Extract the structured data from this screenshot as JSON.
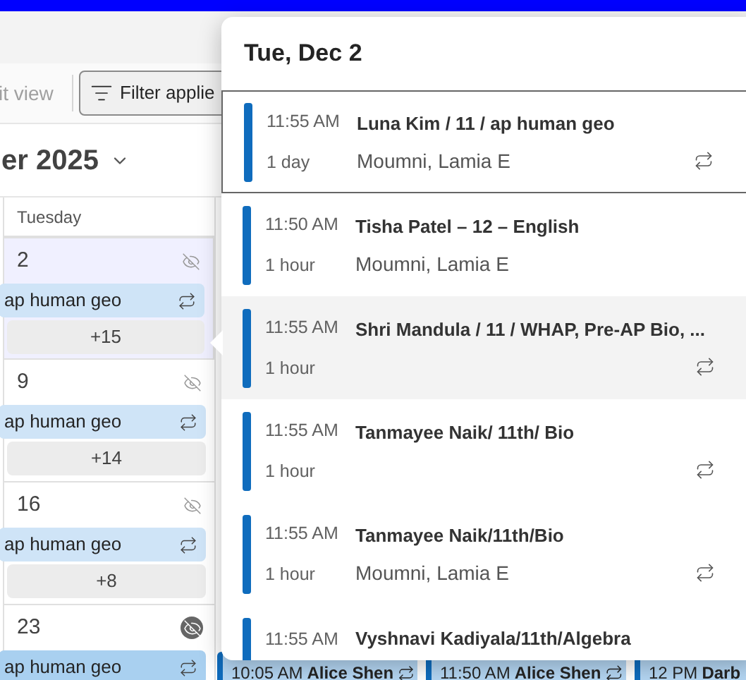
{
  "toolbar": {
    "view_button": "it view",
    "filter_button": "Filter applie"
  },
  "month_title": "er 2025",
  "day_header": "Tuesday",
  "weeks": [
    {
      "date": "2",
      "selected": true,
      "emphasized": false,
      "event": "ap human geo",
      "more": "+15"
    },
    {
      "date": "9",
      "selected": false,
      "emphasized": false,
      "event": "ap human geo",
      "more": "+14"
    },
    {
      "date": "16",
      "selected": false,
      "emphasized": false,
      "event": "ap human geo",
      "more": "+8"
    },
    {
      "date": "23",
      "selected": false,
      "emphasized": true,
      "event": "ap human geo"
    }
  ],
  "bottom_events": [
    {
      "time": "10:05 AM",
      "title": "Alice Shen",
      "recurring": true
    },
    {
      "time": "11:50 AM",
      "title": "Alice Shen",
      "recurring": true
    },
    {
      "time": "12 PM",
      "title": "Darb"
    }
  ],
  "popover": {
    "title": "Tue, Dec 2",
    "items": [
      {
        "time": "11:55 AM",
        "duration": "1 day",
        "title": "Luna Kim / 11 / ap human geo",
        "organizer": "Moumni, Lamia E",
        "recurring": true,
        "focused": true,
        "hovered": false
      },
      {
        "time": "11:50 AM",
        "duration": "1 hour",
        "title": "Tisha Patel – 12 – English",
        "organizer": "Moumni, Lamia E",
        "recurring": false,
        "focused": false,
        "hovered": false
      },
      {
        "time": "11:55 AM",
        "duration": "1 hour",
        "title": "Shri Mandula / 11 / WHAP, Pre-AP Bio, ...",
        "recurring": true,
        "focused": false,
        "hovered": true
      },
      {
        "time": "11:55 AM",
        "duration": "1 hour",
        "title": "Tanmayee Naik/ 11th/ Bio",
        "recurring": true,
        "focused": false,
        "hovered": false
      },
      {
        "time": "11:55 AM",
        "duration": "1 hour",
        "title": "Tanmayee Naik/11th/Bio",
        "organizer": "Moumni, Lamia E",
        "recurring": true,
        "focused": false,
        "hovered": false
      },
      {
        "time": "11:55 AM",
        "title": "Vyshnavi Kadiyala/11th/Algebra",
        "focused": false,
        "hovered": false
      }
    ]
  }
}
